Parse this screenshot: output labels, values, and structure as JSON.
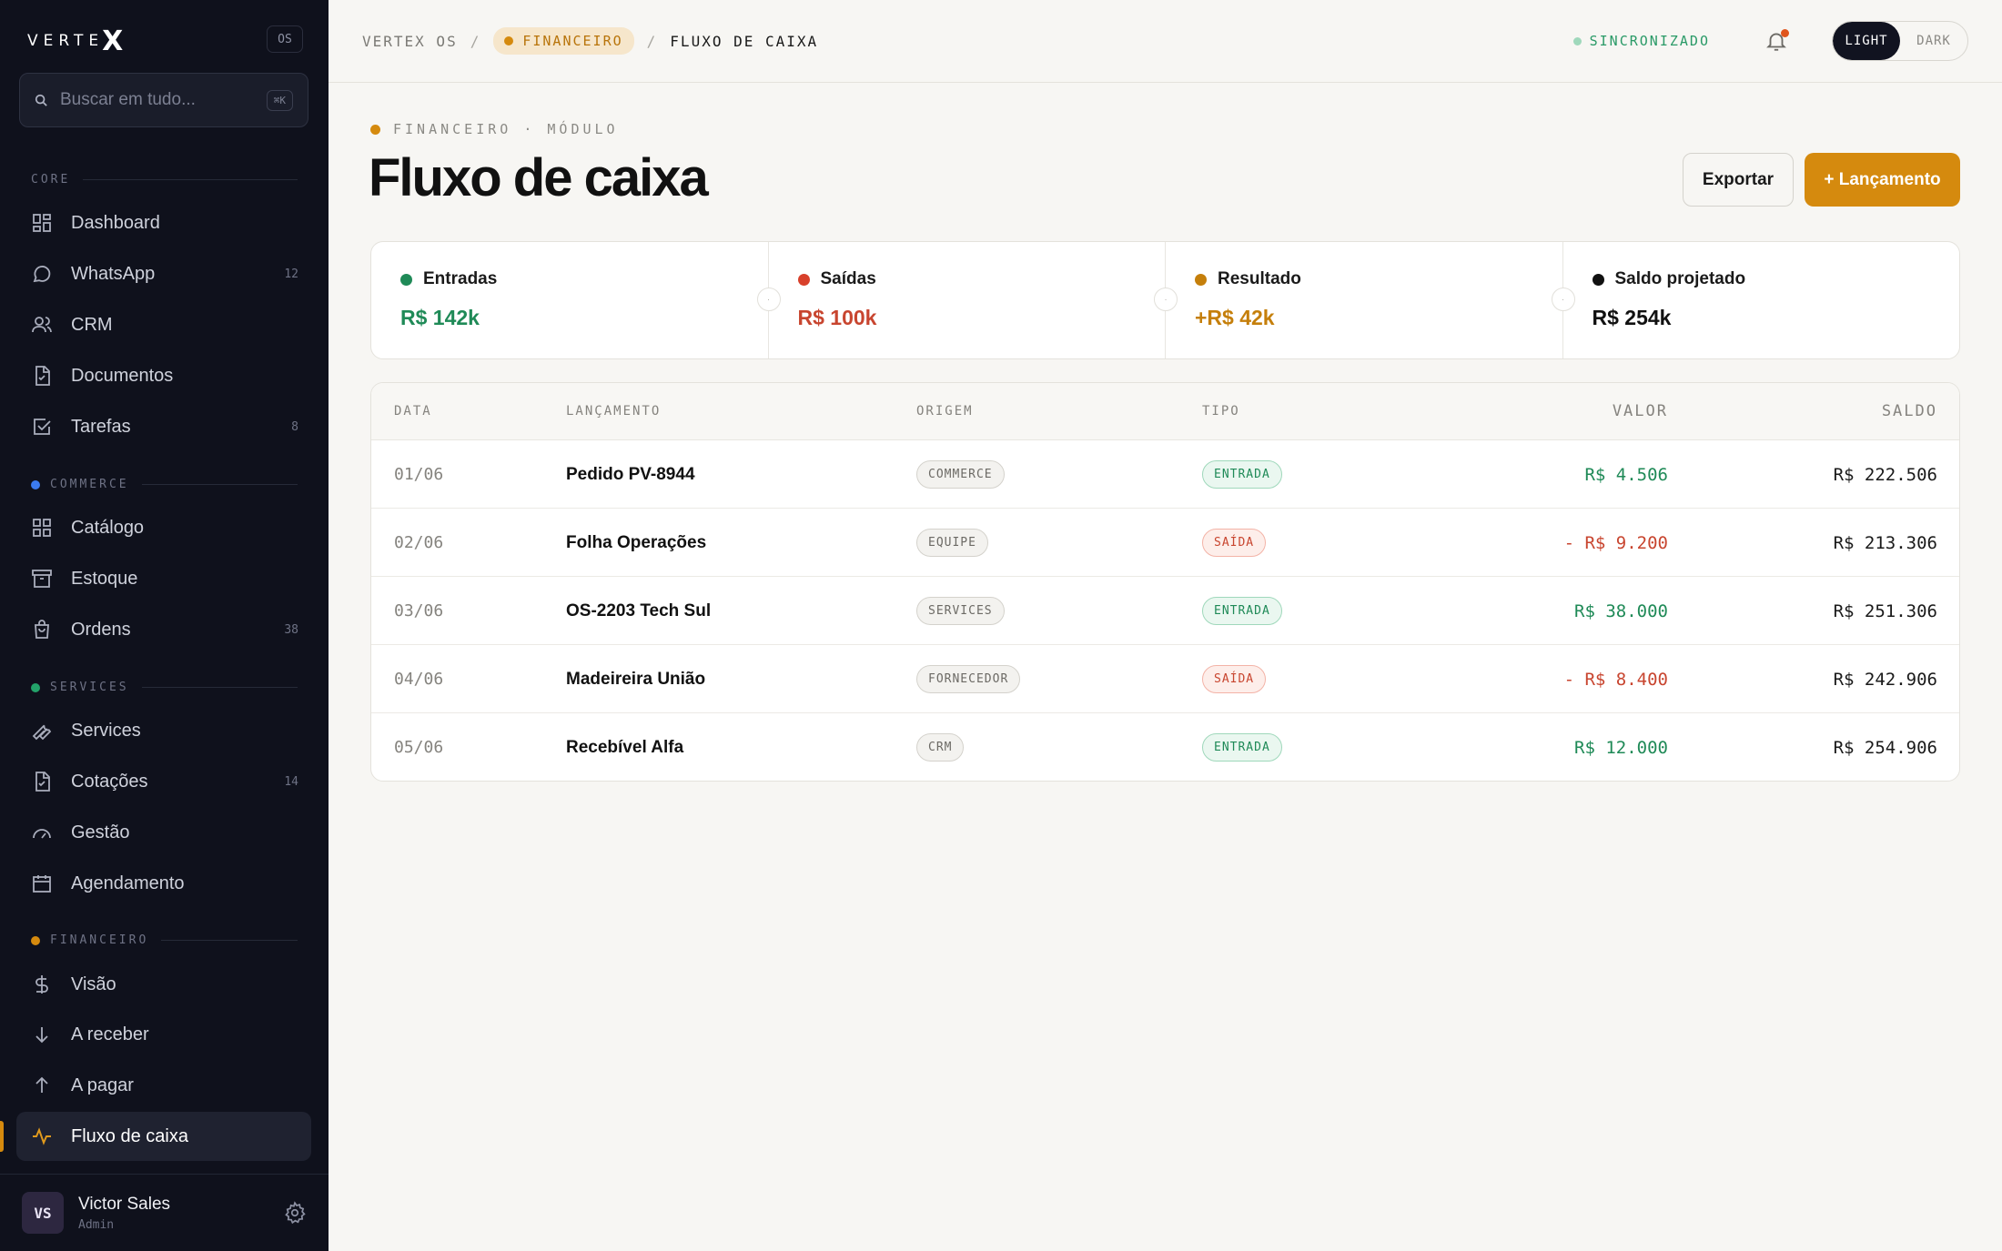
{
  "sidebar": {
    "brand": "VERTE",
    "brand_x": "X",
    "os_badge": "OS",
    "search_placeholder": "Buscar em tudo...",
    "search_shortcut": "⌘K",
    "sections": {
      "core": "CORE",
      "commerce": "COMMERCE",
      "services": "SERVICES",
      "financeiro": "FINANCEIRO"
    },
    "section_colors": {
      "commerce": "#3b7bf0",
      "services": "#23a36a",
      "financeiro": "#d58a0e"
    },
    "items": [
      {
        "label": "Dashboard",
        "icon": "dashboard-icon",
        "count": ""
      },
      {
        "label": "WhatsApp",
        "icon": "chat-icon",
        "count": "12"
      },
      {
        "label": "CRM",
        "icon": "users-icon",
        "count": ""
      },
      {
        "label": "Documentos",
        "icon": "document-check-icon",
        "count": ""
      },
      {
        "label": "Tarefas",
        "icon": "checkbox-icon",
        "count": "8"
      },
      {
        "label": "Catálogo",
        "icon": "grid-icon",
        "count": ""
      },
      {
        "label": "Estoque",
        "icon": "archive-icon",
        "count": ""
      },
      {
        "label": "Ordens",
        "icon": "bag-icon",
        "count": "38"
      },
      {
        "label": "Services",
        "icon": "wrench-icon",
        "count": ""
      },
      {
        "label": "Cotações",
        "icon": "document-check-icon",
        "count": "14"
      },
      {
        "label": "Gestão",
        "icon": "gauge-icon",
        "count": ""
      },
      {
        "label": "Agendamento",
        "icon": "calendar-icon",
        "count": ""
      },
      {
        "label": "Visão",
        "icon": "dollar-icon",
        "count": ""
      },
      {
        "label": "A receber",
        "icon": "arrow-down-icon",
        "count": ""
      },
      {
        "label": "A pagar",
        "icon": "arrow-up-icon",
        "count": ""
      },
      {
        "label": "Fluxo de caixa",
        "icon": "pulse-icon",
        "count": "",
        "active": true
      }
    ],
    "user": {
      "initials": "VS",
      "name": "Victor Sales",
      "role": "Admin"
    }
  },
  "topbar": {
    "crumb_root": "VERTEX OS",
    "crumb_module": "FINANCEIRO",
    "crumb_current": "FLUXO DE CAIXA",
    "sync_status": "SINCRONIZADO",
    "theme_light": "LIGHT",
    "theme_dark": "DARK"
  },
  "header": {
    "eyebrow": "FINANCEIRO · MÓDULO",
    "title": "Fluxo de caixa",
    "export_label": "Exportar",
    "add_label": "+ Lançamento"
  },
  "kpis": [
    {
      "label": "Entradas",
      "value": "R$ 142k",
      "color": "#1f8a57"
    },
    {
      "label": "Saídas",
      "value": "R$ 100k",
      "color": "#d8402b"
    },
    {
      "label": "Resultado",
      "value": "+R$ 42k",
      "color": "#c57f0b"
    },
    {
      "label": "Saldo projetado",
      "value": "R$ 254k",
      "color": "#111111"
    }
  ],
  "kpi_separator": "·",
  "table": {
    "headers": {
      "data": "DATA",
      "lancamento": "LANÇAMENTO",
      "origem": "ORIGEM",
      "tipo": "TIPO",
      "valor": "VALOR",
      "saldo": "SALDO"
    },
    "rows": [
      {
        "data": "01/06",
        "lancamento": "Pedido PV-8944",
        "origem": "COMMERCE",
        "tipo": "ENTRADA",
        "valor": "R$ 4.506",
        "saldo": "R$ 222.506"
      },
      {
        "data": "02/06",
        "lancamento": "Folha Operações",
        "origem": "EQUIPE",
        "tipo": "SAÍDA",
        "valor": "- R$ 9.200",
        "saldo": "R$ 213.306"
      },
      {
        "data": "03/06",
        "lancamento": "OS-2203 Tech Sul",
        "origem": "SERVICES",
        "tipo": "ENTRADA",
        "valor": "R$ 38.000",
        "saldo": "R$ 251.306"
      },
      {
        "data": "04/06",
        "lancamento": "Madeireira União",
        "origem": "FORNECEDOR",
        "tipo": "SAÍDA",
        "valor": "- R$ 8.400",
        "saldo": "R$ 242.906"
      },
      {
        "data": "05/06",
        "lancamento": "Recebível Alfa",
        "origem": "CRM",
        "tipo": "ENTRADA",
        "valor": "R$ 12.000",
        "saldo": "R$ 254.906"
      }
    ]
  }
}
